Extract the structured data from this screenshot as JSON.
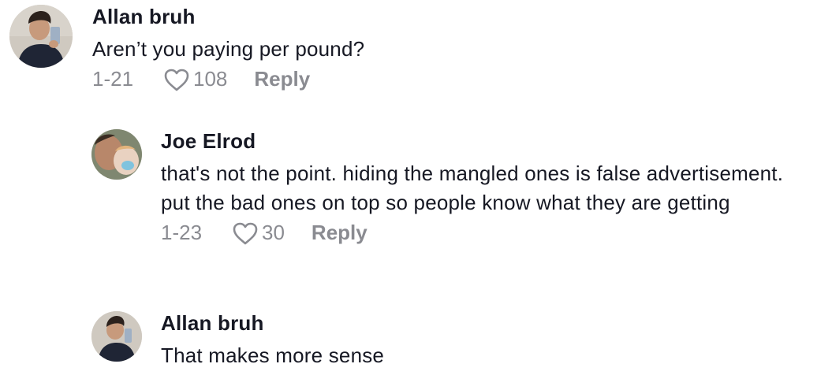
{
  "comments": [
    {
      "username": "Allan bruh",
      "text": "Aren’t you paying per pound?",
      "date": "1-21",
      "likes": "108",
      "reply_label": "Reply"
    },
    {
      "username": "Joe Elrod",
      "text": "that's not the point. hiding the mangled ones is false advertisement. put the bad ones on top so people know what they are getting",
      "date": "1-23",
      "likes": "30",
      "reply_label": "Reply"
    },
    {
      "username": "Allan bruh",
      "text": "That makes more sense"
    }
  ],
  "icons": {
    "like": "heart-outline-icon",
    "avatar": "user-avatar"
  },
  "colors": {
    "text": "#161823",
    "meta": "#8a8b91",
    "background": "#ffffff"
  }
}
